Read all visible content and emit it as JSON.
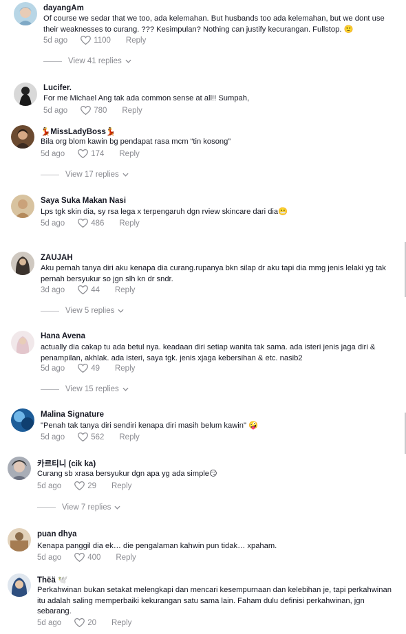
{
  "comments": [
    {
      "username": "dayangAm",
      "text": "Of course we sedar that we too, ada kelemahan. But husbands too ada kelemahan, but we dont use their weaknesses to curang. ??? Kesimpulan? Nothing can justify kecurangan. Fullstop. 🙂",
      "time": "5d ago",
      "likes": "1100",
      "reply": "Reply",
      "view_replies": "View 41 replies",
      "avatar_color": "#9ec3d9"
    },
    {
      "username": "Lucifer.",
      "text": "For me Michael Ang tak ada common sense at all!! Sumpah,",
      "time": "5d ago",
      "likes": "780",
      "reply": "Reply",
      "avatar_color": "#2a2a2a"
    },
    {
      "username": "💃MissLadyBoss💃",
      "text": "Bila org blom kawin bg pendapat rasa mcm “tin kosong”",
      "time": "5d ago",
      "likes": "174",
      "reply": "Reply",
      "view_replies": "View 17 replies",
      "avatar_color": "#7e5a3c"
    },
    {
      "username": "Saya Suka Makan Nasi",
      "text": "Lps tgk skin dia, sy rsa lega x terpengaruh dgn rview skincare dari dia😬",
      "time": "5d ago",
      "likes": "486",
      "reply": "Reply",
      "avatar_color": "#c9a678"
    },
    {
      "username": "ZAUJAH",
      "text": "Aku pernah tanya diri aku kenapa dia curang.rupanya bkn silap dr aku tapi dia mmg jenis lelaki yg tak pernah bersyukur so jgn slh kn dr sndr.",
      "time": "3d ago",
      "likes": "44",
      "reply": "Reply",
      "view_replies": "View 5 replies",
      "avatar_color": "#4a4038"
    },
    {
      "username": "Hana Avena",
      "text": "actually dia cakap tu ada betul nya. keadaan diri setiap wanita tak sama. ada isteri jenis jaga diri & penampilan, akhlak. ada isteri, saya tgk. jenis xjaga kebersihan & etc. nasib2",
      "time": "5d ago",
      "likes": "49",
      "reply": "Reply",
      "view_replies": "View 15 replies",
      "avatar_color": "#e9d4d6"
    },
    {
      "username": "Malina Signature",
      "text": "\"Penah tak tanya diri sendiri kenapa diri masih belum kawin\" 🤪",
      "time": "5d ago",
      "likes": "562",
      "reply": "Reply",
      "avatar_color": "#2d6fa8"
    },
    {
      "username": "카르티니 (cik ka)",
      "text": "Curang sb xrasa bersyukur dgn apa yg ada simple😏",
      "time": "5d ago",
      "likes": "29",
      "reply": "Reply",
      "view_replies": "View 7 replies",
      "avatar_color": "#8a8f9a"
    },
    {
      "username": "puan dhya",
      "text": "Kenapa panggil dia ek… die pengalaman kahwin pun tidak… xpaham.",
      "time": "5d ago",
      "likes": "400",
      "reply": "Reply",
      "avatar_color": "#b7946e"
    },
    {
      "username": "Thëä 🕊️",
      "text": "Perkahwinan bukan setakat melengkapi dan mencari kesempurnaan dan kelebihan je, tapi perkahwinan itu adalah saling memperbaiki kekurangan satu sama lain. Faham dulu definisi perkahwinan, jgn sebarang.",
      "time": "5d ago",
      "likes": "20",
      "reply": "Reply",
      "avatar_color": "#3a5a8a"
    }
  ]
}
